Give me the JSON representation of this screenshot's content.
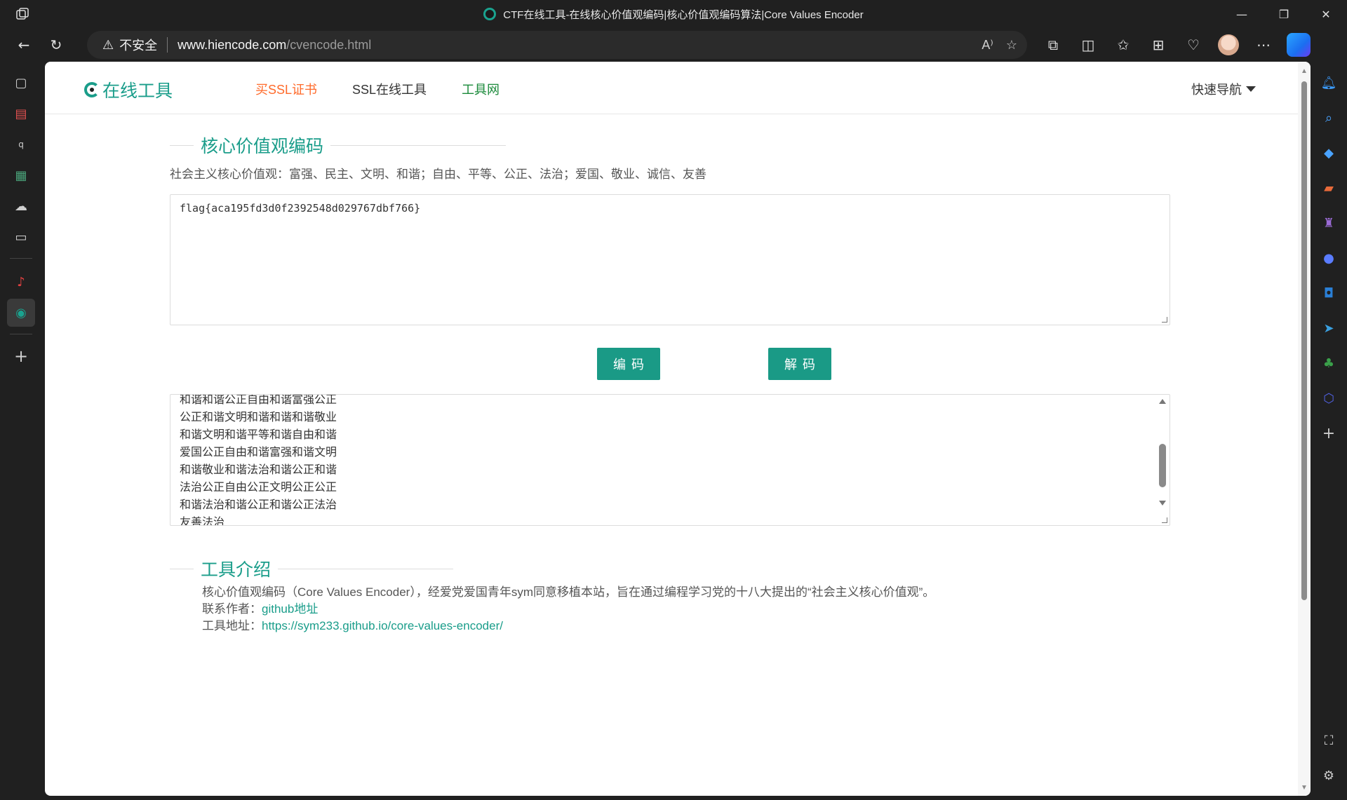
{
  "browser": {
    "window_title": "CTF在线工具-在线核心价值观编码|核心价值观编码算法|Core Values Encoder",
    "address": {
      "security_label": "不安全",
      "host": "www.hiencode.com",
      "path": "/cvencode.html"
    },
    "window_controls": [
      "minimize",
      "restore",
      "close"
    ]
  },
  "site": {
    "logo_text": "在线工具",
    "nav": [
      {
        "label": "买SSL证书",
        "color": "#ff6a2a"
      },
      {
        "label": "SSL在线工具",
        "color": "#333333"
      },
      {
        "label": "工具网",
        "color": "#1a8a3a"
      }
    ],
    "quick_nav": "快速导航"
  },
  "main": {
    "title": "核心价值观编码",
    "subtitle": "社会主义核心价值观：富强、民主、文明、和谐；自由、平等、公正、法治；爱国、敬业、诚信、友善",
    "input_value": "flag{aca195fd3d0f2392548d029767dbf766}",
    "encode_label": "编码",
    "decode_label": "解码",
    "output_lines": [
      "和谐和谐公正自由和谐富强公正",
      "公正和谐文明和谐和谐和谐敬业",
      "和谐文明和谐平等和谐自由和谐",
      "爱国公正自由和谐富强和谐文明",
      "和谐敬业和谐法治和谐公正和谐",
      "法治公正自由公正文明公正公正",
      "和谐法治和谐公正和谐公正法治",
      "友善法治"
    ]
  },
  "intro": {
    "title": "工具介绍",
    "description": "核心价值观编码（Core Values Encoder），经爱党爱国青年sym同意移植本站，旨在通过编程学习党的十八大提出的“社会主义核心价值观”。",
    "contact_label": "联系作者：",
    "contact_link": "github地址",
    "tool_label": "工具地址：",
    "tool_link": "https://sym233.github.io/core-values-encoder/"
  },
  "colors": {
    "accent": "#1a9d8a",
    "button": "#1a9a86",
    "chrome_bg": "#202020"
  }
}
